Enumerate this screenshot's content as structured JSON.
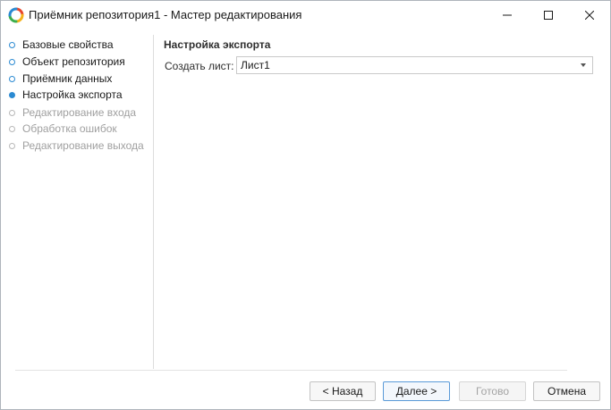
{
  "window": {
    "title": "Приёмник репозитория1 - Мастер редактирования"
  },
  "steps": [
    {
      "label": "Базовые свойства",
      "state": "done"
    },
    {
      "label": "Объект репозитория",
      "state": "done"
    },
    {
      "label": "Приёмник данных",
      "state": "done"
    },
    {
      "label": "Настройка экспорта",
      "state": "active"
    },
    {
      "label": "Редактирование входа",
      "state": "todo"
    },
    {
      "label": "Обработка ошибок",
      "state": "todo"
    },
    {
      "label": "Редактирование выхода",
      "state": "todo"
    }
  ],
  "main": {
    "section_title": "Настройка экспорта",
    "create_sheet": {
      "label": "Создать лист:",
      "value": "Лист1"
    }
  },
  "footer": {
    "back_label": "< Назад",
    "next_label": "Далее >",
    "finish_label": "Готово",
    "cancel_label": "Отмена"
  },
  "colors": {
    "accent": "#2b8ad2",
    "disabled_text": "#a0a0a0"
  }
}
